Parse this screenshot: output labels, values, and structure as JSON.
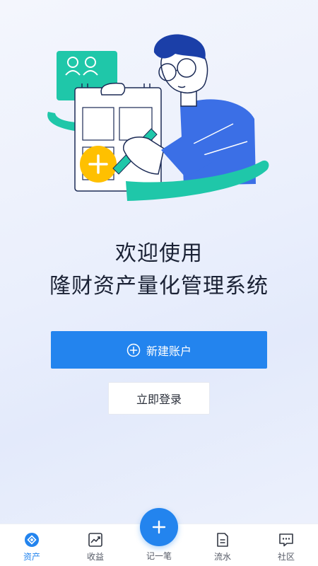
{
  "welcome": {
    "line1": "欢迎使用",
    "line2": "隆财资产量化管理系统"
  },
  "actions": {
    "create_account": "新建账户",
    "login": "立即登录"
  },
  "tabbar": {
    "items": [
      {
        "label": "资产",
        "icon": "asset-icon",
        "active": true
      },
      {
        "label": "收益",
        "icon": "chart-icon",
        "active": false
      },
      {
        "label": "记一笔",
        "icon": "plus-icon",
        "active": false
      },
      {
        "label": "流水",
        "icon": "document-icon",
        "active": false
      },
      {
        "label": "社区",
        "icon": "chat-icon",
        "active": false
      }
    ]
  },
  "colors": {
    "accent": "#2384ee",
    "illustration_green": "#1fc7a9",
    "illustration_blue": "#3b6fe6",
    "illustration_yellow": "#ffc000",
    "text_dark": "#1b2235"
  }
}
